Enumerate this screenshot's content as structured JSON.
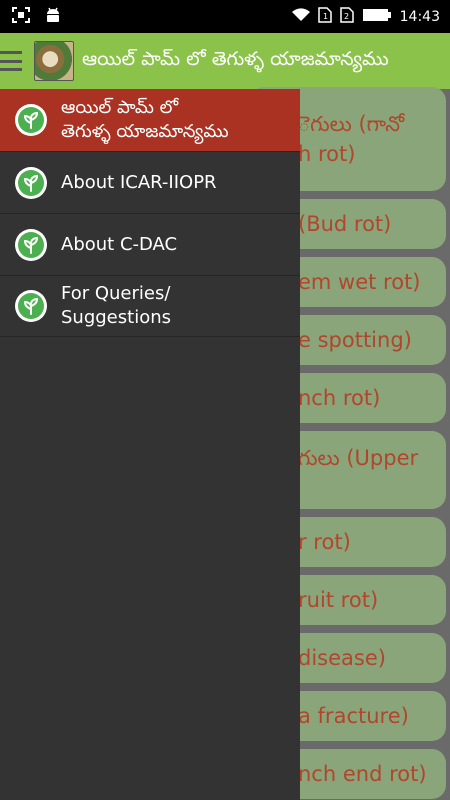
{
  "status_bar": {
    "time": "14:43",
    "left_icons": [
      "screenshot-icon",
      "android-icon"
    ],
    "right_icons": [
      "wifi-icon",
      "sim-1-icon",
      "sim-2-icon",
      "battery-icon"
    ]
  },
  "app_bar": {
    "title": "ఆయిల్ పామ్ లో తెగుళ్ళ యాజమాన్యము",
    "icons": [
      "hamburger-icon",
      "app-logo"
    ]
  },
  "drawer": {
    "items": [
      {
        "label": "ఆయిల్ పామ్ లో\nతెగుళ్ళ యాజమాన్యము",
        "selected": true,
        "icon": "leaf-icon"
      },
      {
        "label": "About ICAR-IIOPR",
        "selected": false,
        "icon": "leaf-icon"
      },
      {
        "label": "About C-DAC",
        "selected": false,
        "icon": "leaf-icon"
      },
      {
        "label": "For Queries/\nSuggestions",
        "selected": false,
        "icon": "leaf-icon"
      }
    ]
  },
  "background_list": {
    "items": [
      {
        "text": "ెగులు (గానో\nh rot)"
      },
      {
        "text": "(Bud rot)"
      },
      {
        "text": "em wet rot)"
      },
      {
        "text": "e spotting)"
      },
      {
        "text": "nch rot)"
      },
      {
        "text": "గులు (Upper"
      },
      {
        "text": "r rot)"
      },
      {
        "text": "ruit rot)"
      },
      {
        "text": "disease)"
      },
      {
        "text": "a fracture)"
      },
      {
        "text": "nch end rot)"
      }
    ]
  },
  "colors": {
    "app_bar": "#8bc34a",
    "drawer_bg": "#333333",
    "selected_item": "#a93222",
    "status_bar": "#000000",
    "list_text": "#b0462c"
  }
}
